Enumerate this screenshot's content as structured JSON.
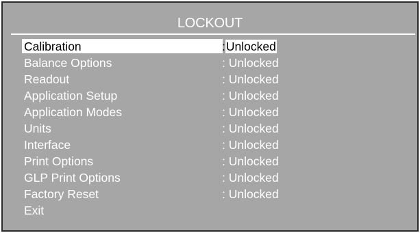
{
  "title": "LOCKOUT",
  "items": [
    {
      "label": "Calibration",
      "separator": ":",
      "value": "Unlocked"
    },
    {
      "label": "Balance Options",
      "separator": ":",
      "value": "Unlocked"
    },
    {
      "label": "Readout",
      "separator": ":",
      "value": "Unlocked"
    },
    {
      "label": "Application Setup",
      "separator": ":",
      "value": "Unlocked"
    },
    {
      "label": "Application Modes",
      "separator": ":",
      "value": "Unlocked"
    },
    {
      "label": "Units",
      "separator": ":",
      "value": "Unlocked"
    },
    {
      "label": "Interface",
      "separator": ":",
      "value": "Unlocked"
    },
    {
      "label": "Print Options",
      "separator": ":",
      "value": "Unlocked"
    },
    {
      "label": "GLP Print Options",
      "separator": ":",
      "value": "Unlocked"
    },
    {
      "label": "Factory Reset",
      "separator": ":",
      "value": "Unlocked"
    }
  ],
  "exit_label": "Exit",
  "colors": {
    "screen_bg": "#a6a6a6",
    "text": "#ffffff",
    "highlight_bg": "#ffffff",
    "highlight_text": "#000000"
  }
}
